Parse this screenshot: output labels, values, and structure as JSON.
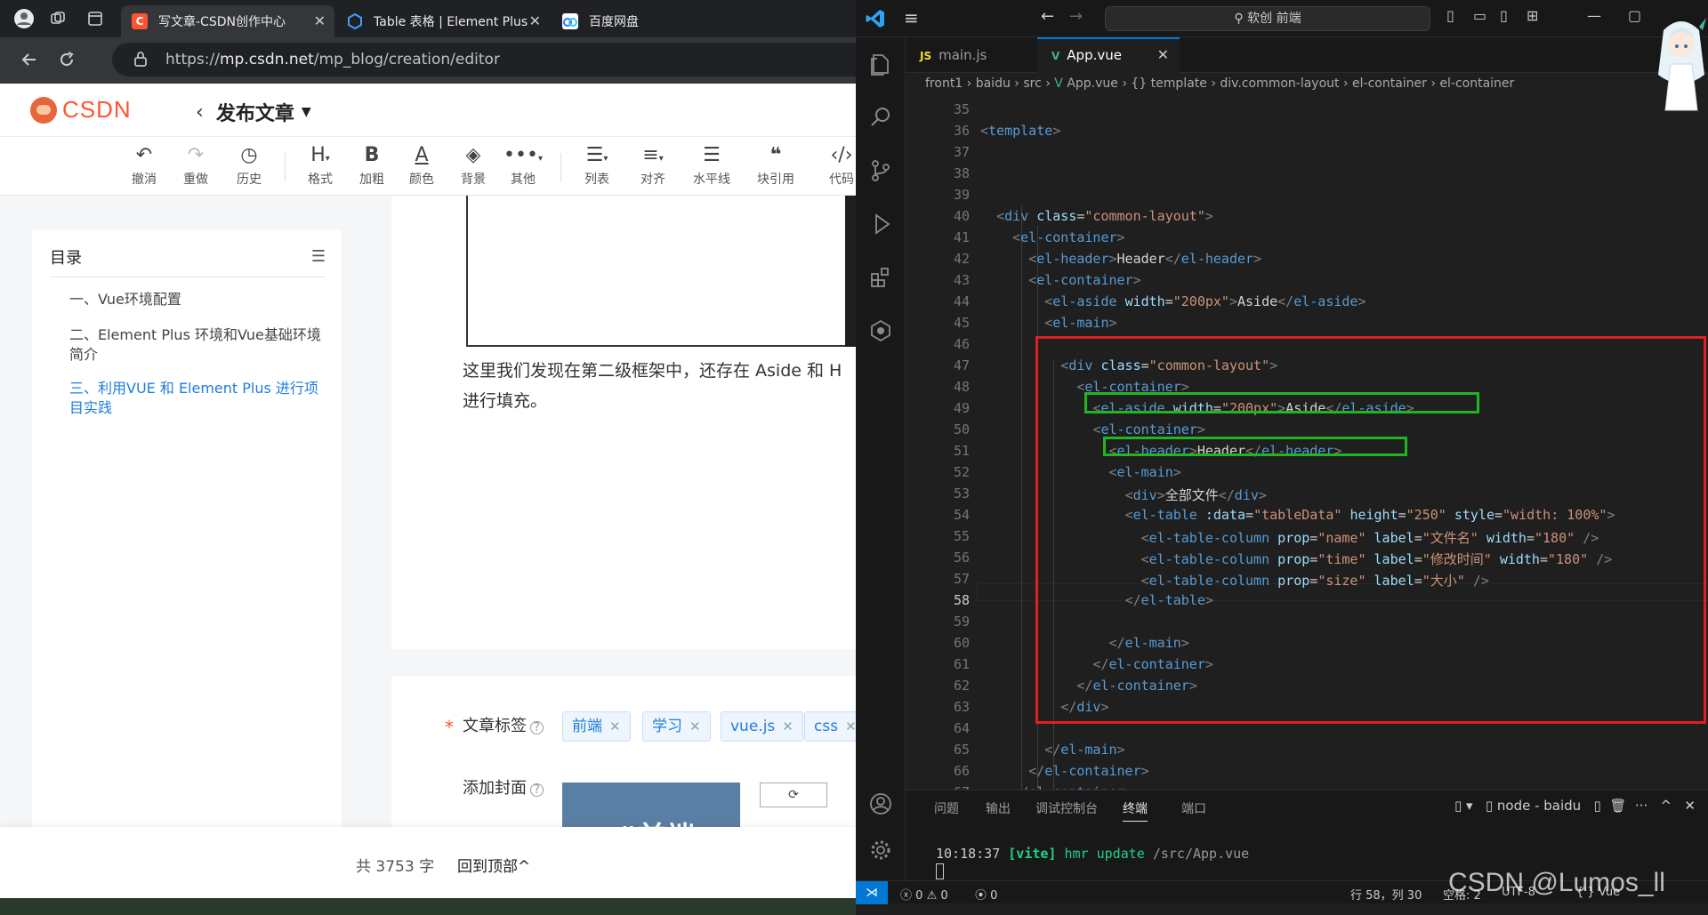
{
  "browser": {
    "tabs": [
      {
        "title": "写文章-CSDN创作中心",
        "active": true,
        "favicon": "csdn-icon",
        "favicon_color": "#fc5531"
      },
      {
        "title": "Table 表格 | Element Plus",
        "active": false,
        "favicon": "element-plus-icon",
        "favicon_color": "#409eff"
      },
      {
        "title": "百度网盘",
        "active": false,
        "favicon": "baidu-pan-icon",
        "favicon_color": "#2b7cf6"
      }
    ],
    "url_prefix": "https://",
    "url_host": "mp.csdn.net",
    "url_path": "/mp_blog/creation/editor"
  },
  "csdn": {
    "brand_color": "#fc5531",
    "logo_text": "CSDN",
    "page_title": "发布文章",
    "toolbar": [
      {
        "label": "撤消",
        "icon": "undo-icon"
      },
      {
        "label": "重做",
        "icon": "redo-icon"
      },
      {
        "label": "历史",
        "icon": "history-icon"
      },
      {
        "label": "格式",
        "icon": "heading-icon"
      },
      {
        "label": "加粗",
        "icon": "bold-icon"
      },
      {
        "label": "颜色",
        "icon": "font-color-icon"
      },
      {
        "label": "背景",
        "icon": "paint-bucket-icon"
      },
      {
        "label": "其他",
        "icon": "more-icon"
      },
      {
        "label": "列表",
        "icon": "list-icon"
      },
      {
        "label": "对齐",
        "icon": "align-icon"
      },
      {
        "label": "水平线",
        "icon": "horizontal-rule-icon"
      },
      {
        "label": "块引用",
        "icon": "quote-icon"
      },
      {
        "label": "代码",
        "icon": "code-icon"
      }
    ],
    "toc": {
      "title": "目录",
      "items": [
        {
          "text": "一、Vue环境配置",
          "active": false
        },
        {
          "text": "二、Element Plus 环境和Vue基础环境 简介",
          "active": false
        },
        {
          "text": "三、利用VUE 和 Element Plus 进行项目实践",
          "active": true
        }
      ]
    },
    "editor_paragraph_line1": "这里我们发现在第二级框架中，还存在 Aside 和 H",
    "editor_paragraph_line2": "进行填充。",
    "tags_label": "文章标签",
    "tags": [
      "前端",
      "学习",
      "vue.js",
      "css"
    ],
    "cover_label": "添加封面",
    "cover_text": "#前端",
    "footer": {
      "word_count": "共 3753 字",
      "back_to_top": "回到顶部"
    }
  },
  "vscode": {
    "command_center": "软创 前端",
    "tabs": [
      {
        "lang": "JS",
        "name": "main.js",
        "active": false
      },
      {
        "lang": "V",
        "name": "App.vue",
        "active": true
      }
    ],
    "breadcrumbs": [
      "front1",
      "baidu",
      "src",
      "App.vue",
      "{} template",
      "div.common-layout",
      "el-container",
      "el-container"
    ],
    "current_line": 58,
    "panel_tabs": [
      "问题",
      "输出",
      "调试控制台",
      "终端",
      "端口"
    ],
    "active_panel_tab": "终端",
    "terminal_name": "node - baidu",
    "terminal_time": "10:18:37",
    "terminal_tag": "[vite]",
    "terminal_msg": "hmr update",
    "terminal_path": "/src/App.vue",
    "status": {
      "errors": "0",
      "warnings": "0",
      "ports": "0",
      "position": "行 58，列 30",
      "spaces": "空格: 2",
      "encoding": "UTF-8",
      "language": "Vue"
    }
  },
  "watermark": "CSDN @Lumos_ll"
}
